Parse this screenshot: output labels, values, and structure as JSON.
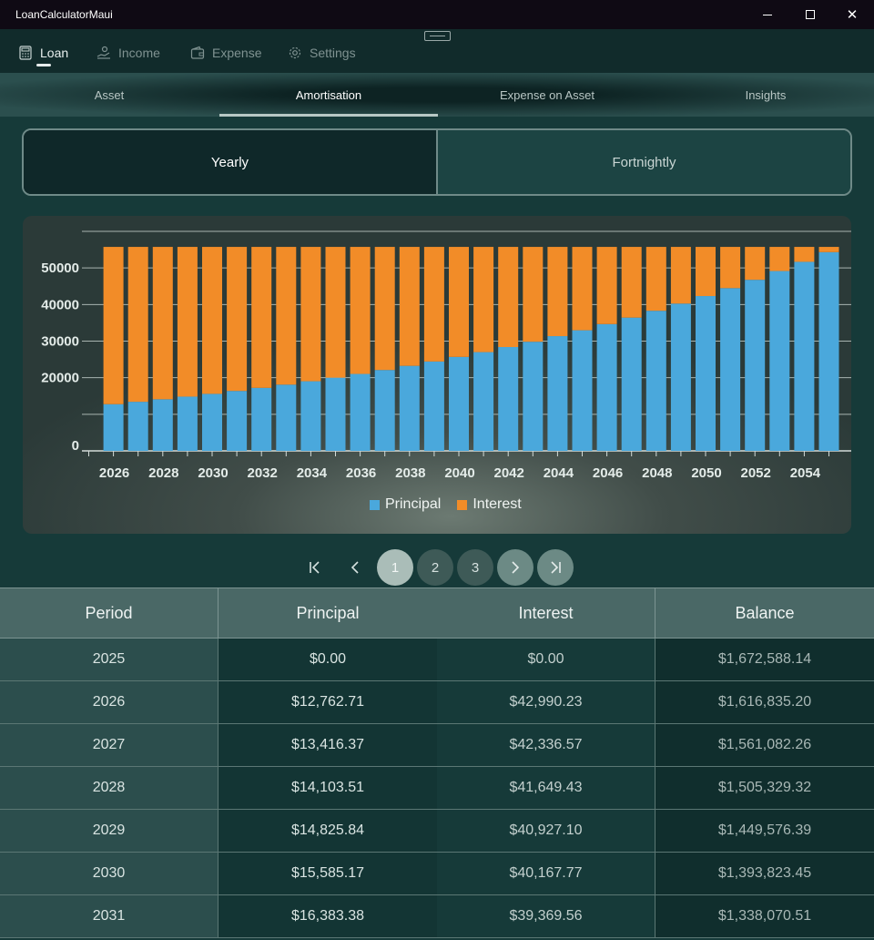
{
  "window": {
    "title": "LoanCalculatorMaui",
    "minimize_label": "—",
    "maximize_label": "☐",
    "close_label": "✕"
  },
  "nav": {
    "items": [
      {
        "label": "Loan",
        "icon": "calculator-icon"
      },
      {
        "label": "Income",
        "icon": "income-icon"
      },
      {
        "label": "Expense",
        "icon": "wallet-icon"
      },
      {
        "label": "Settings",
        "icon": "gear-icon"
      }
    ],
    "active": "Loan"
  },
  "tabs": {
    "items": [
      "Asset",
      "Amortisation",
      "Expense on Asset",
      "Insights"
    ],
    "active": "Amortisation"
  },
  "segment": {
    "options": [
      "Yearly",
      "Fortnightly"
    ],
    "selected": "Yearly"
  },
  "chart_data": {
    "type": "bar",
    "stacked": true,
    "categories": [
      "2025",
      "2026",
      "2027",
      "2028",
      "2029",
      "2030",
      "2031",
      "2032",
      "2033",
      "2034",
      "2035",
      "2036",
      "2037",
      "2038",
      "2039",
      "2040",
      "2041",
      "2042",
      "2043",
      "2044",
      "2045",
      "2046",
      "2047",
      "2048",
      "2049",
      "2050",
      "2051",
      "2052",
      "2053",
      "2054",
      "2055"
    ],
    "series": [
      {
        "name": "Principal",
        "color": "#4aa8dc",
        "values": [
          0,
          12762.71,
          13416.37,
          14103.51,
          14825.84,
          15585.17,
          16383.38,
          17222,
          18104,
          19031,
          20006,
          21030,
          22107,
          23240,
          24430,
          25681,
          26996,
          28379,
          29832,
          31360,
          32966,
          34654,
          36429,
          38295,
          40256,
          42318,
          44485,
          46763,
          49158,
          51676,
          54322
        ]
      },
      {
        "name": "Interest",
        "color": "#f28c28",
        "values": [
          0,
          42990.23,
          42336.57,
          41649.43,
          40927.1,
          40167.77,
          39369.56,
          38531,
          37649,
          36722,
          35747,
          34723,
          33646,
          32513,
          31323,
          30072,
          28757,
          27374,
          25921,
          24393,
          22787,
          21099,
          19324,
          17458,
          15497,
          13435,
          11268,
          8990,
          6595,
          4077,
          1431
        ]
      }
    ],
    "y_ticks": [
      0,
      20000,
      30000,
      40000,
      50000
    ],
    "x_ticks": [
      "2026",
      "2028",
      "2030",
      "2032",
      "2034",
      "2036",
      "2038",
      "2040",
      "2042",
      "2044",
      "2046",
      "2048",
      "2050",
      "2052",
      "2054"
    ],
    "ylim": [
      0,
      60000
    ],
    "grid": true,
    "legend_position": "bottom-center"
  },
  "pager": {
    "pages": [
      "1",
      "2",
      "3"
    ],
    "current": "1"
  },
  "table": {
    "headers": [
      "Period",
      "Principal",
      "Interest",
      "Balance"
    ],
    "rows": [
      [
        "2025",
        "$0.00",
        "$0.00",
        "$1,672,588.14"
      ],
      [
        "2026",
        "$12,762.71",
        "$42,990.23",
        "$1,616,835.20"
      ],
      [
        "2027",
        "$13,416.37",
        "$42,336.57",
        "$1,561,082.26"
      ],
      [
        "2028",
        "$14,103.51",
        "$41,649.43",
        "$1,505,329.32"
      ],
      [
        "2029",
        "$14,825.84",
        "$40,927.10",
        "$1,449,576.39"
      ],
      [
        "2030",
        "$15,585.17",
        "$40,167.77",
        "$1,393,823.45"
      ],
      [
        "2031",
        "$16,383.38",
        "$39,369.56",
        "$1,338,070.51"
      ]
    ]
  }
}
